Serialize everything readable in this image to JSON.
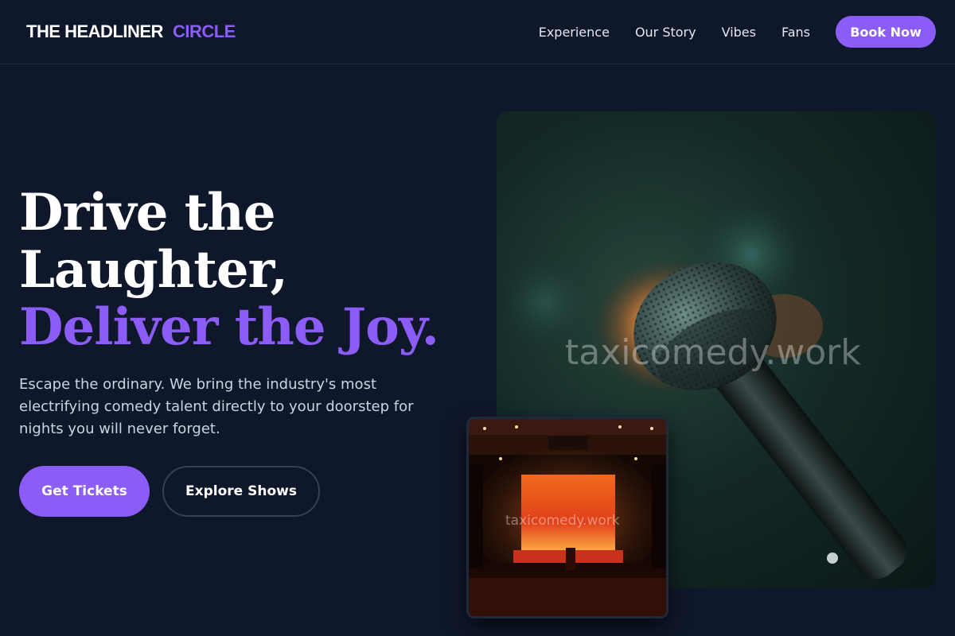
{
  "header": {
    "logo_part1": "THE HEADLINER",
    "logo_part2": "CIRCLE",
    "nav": [
      "Experience",
      "Our Story",
      "Vibes",
      "Fans"
    ],
    "cta": "Book Now"
  },
  "hero": {
    "title_line1": "Drive the",
    "title_line2": "Laughter,",
    "title_accent": "Deliver the Joy.",
    "subtitle": "Escape the ordinary. We bring the industry's most electrifying comedy talent directly to your doorstep for nights you will never forget.",
    "primary_button": "Get Tickets",
    "secondary_button": "Explore Shows"
  },
  "images": {
    "main_watermark": "taxicomedy.work",
    "stage_watermark": "taxicomedy.work"
  },
  "colors": {
    "background": "#0f172a",
    "accent": "#8b5cf6",
    "text": "#ffffff",
    "muted_text": "#cbd5e1"
  }
}
